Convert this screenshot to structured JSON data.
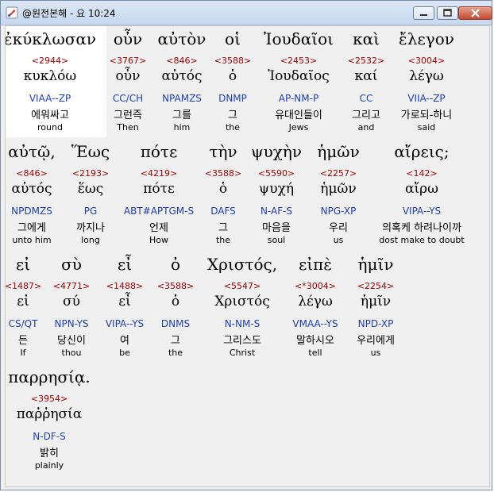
{
  "window": {
    "title": "@원전본해 - 요 10:24",
    "icon": "app-icon",
    "buttons": [
      "minimize-icon",
      "maximize-icon",
      "close-icon"
    ]
  },
  "lines": [
    [
      {
        "greek": "ἐκύκλωσαν",
        "strong": "<2944>",
        "lemma": "κυκλόω",
        "morph": "VIAA--ZP",
        "korean": "에워싸고",
        "english": "round"
      },
      {
        "greek": "οὖν",
        "strong": "<3767>",
        "lemma": "οὖν",
        "morph": "CC/CH",
        "korean": "그런즉",
        "english": "Then"
      },
      {
        "greek": "αὐτὸν",
        "strong": "<846>",
        "lemma": "αὐτός",
        "morph": "NPAMZS",
        "korean": "그를",
        "english": "him"
      },
      {
        "greek": "οἱ",
        "strong": "<3588>",
        "lemma": "ὁ",
        "morph": "DNMP",
        "korean": "그",
        "english": "the"
      },
      {
        "greek": "Ἰουδαῖοι",
        "strong": "<2453>",
        "lemma": "Ἰουδαῖος",
        "morph": "AP-NM-P",
        "korean": "유대인들이",
        "english": "Jews"
      },
      {
        "greek": "καὶ",
        "strong": "<2532>",
        "lemma": "καί",
        "morph": "CC",
        "korean": "그리고",
        "english": "and"
      },
      {
        "greek": "ἔλεγον",
        "strong": "<3004>",
        "lemma": "λέγω",
        "morph": "VIIA--ZP",
        "korean": "가로되-하니",
        "english": "said"
      }
    ],
    [
      {
        "greek": "αὐτῷ,",
        "strong": "<846>",
        "lemma": "αὐτός",
        "morph": "NPDMZS",
        "korean": "그에게",
        "english": "unto him"
      },
      {
        "greek": "Ἕως",
        "strong": "<2193>",
        "lemma": "ἕως",
        "morph": "PG",
        "korean": "까지나",
        "english": "long"
      },
      {
        "greek": "πότε",
        "strong": "<4219>",
        "lemma": "πότε",
        "morph": "ABT#APTGM-S",
        "korean": "언제",
        "english": "How"
      },
      {
        "greek": "τὴν",
        "strong": "<3588>",
        "lemma": "ὁ",
        "morph": "DAFS",
        "korean": "그",
        "english": "the"
      },
      {
        "greek": "ψυχὴν",
        "strong": "<5590>",
        "lemma": "ψυχή",
        "morph": "N-AF-S",
        "korean": "마음을",
        "english": "soul"
      },
      {
        "greek": "ἡμῶν",
        "strong": "<2257>",
        "lemma": "ἡμῶν",
        "morph": "NPG-XP",
        "korean": "우리",
        "english": "us"
      },
      {
        "greek": "αἴρεις;",
        "strong": "<142>",
        "lemma": "αἴρω",
        "morph": "VIPA--YS",
        "korean": "의혹케 하려나이까",
        "english": "dost make to doubt"
      }
    ],
    [
      {
        "greek": "εἰ",
        "strong": "<1487>",
        "lemma": "εἰ",
        "morph": "CS/QT",
        "korean": "든",
        "english": "If"
      },
      {
        "greek": "σὺ",
        "strong": "<4771>",
        "lemma": "σύ",
        "morph": "NPN-YS",
        "korean": "당신이",
        "english": "thou"
      },
      {
        "greek": "εἶ",
        "strong": "<1488>",
        "lemma": "εἶ",
        "morph": "VIPA--YS",
        "korean": "여",
        "english": "be"
      },
      {
        "greek": "ὁ",
        "strong": "<3588>",
        "lemma": "ὁ",
        "morph": "DNMS",
        "korean": "그",
        "english": "the"
      },
      {
        "greek": "Χριστός,",
        "strong": "<5547>",
        "lemma": "Χριστός",
        "morph": "N-NM-S",
        "korean": "그리스도",
        "english": "Christ"
      },
      {
        "greek": "εἰπὲ",
        "strong": "<*3004>",
        "lemma": "λέγω",
        "morph": "VMAA--YS",
        "korean": "말하시오",
        "english": "tell"
      },
      {
        "greek": "ἡμῖν",
        "strong": "<2254>",
        "lemma": "ἡμῖν",
        "morph": "NPD-XP",
        "korean": "우리에게",
        "english": "us"
      }
    ],
    [
      {
        "greek": "παρρησίᾳ.",
        "strong": "<3954>",
        "lemma": "παῤῥησία",
        "morph": "N-DF-S",
        "korean": "밝히",
        "english": "plainly"
      }
    ]
  ]
}
